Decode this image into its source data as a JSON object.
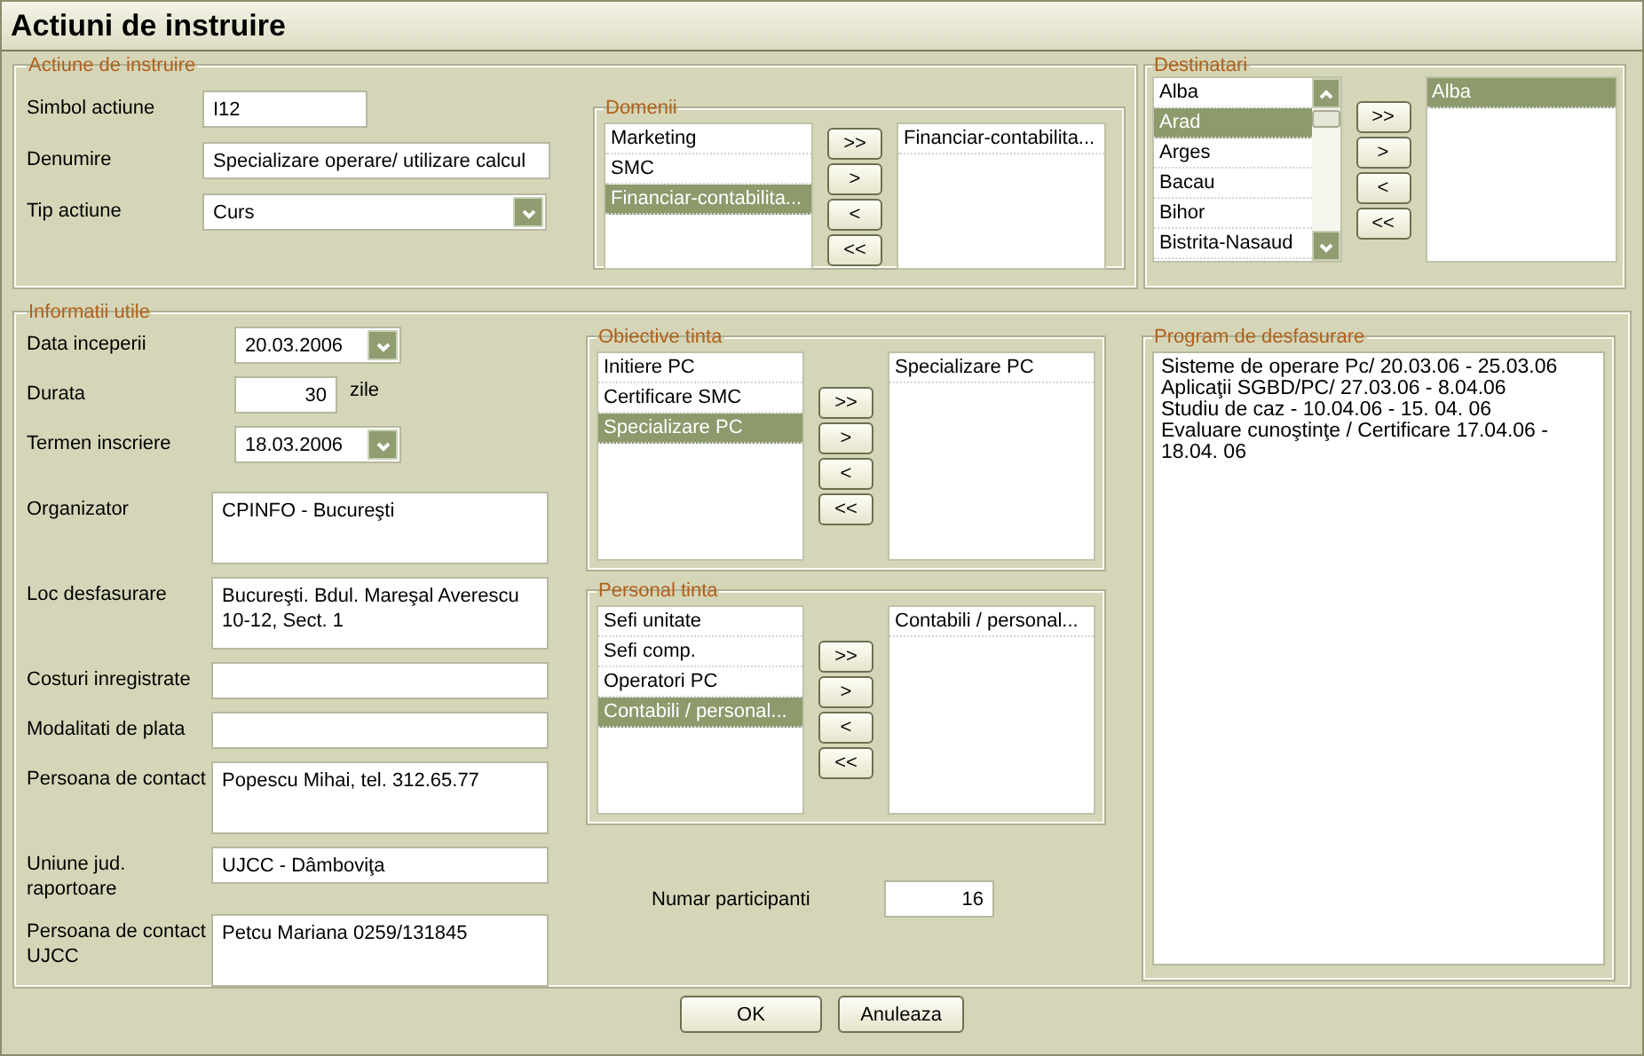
{
  "window": {
    "title": "Actiuni de instruire"
  },
  "actiune": {
    "title": "Actiune de instruire",
    "fields": [
      {
        "label": "Simbol actiune",
        "value": "I12",
        "kind": "short"
      },
      {
        "label": "Denumire",
        "value": "Specializare operare/ utilizare calcul",
        "kind": "text"
      },
      {
        "label": "Tip actiune",
        "value": "Curs",
        "kind": "dropdown"
      }
    ],
    "domenii": {
      "title": "Domenii",
      "available": [
        {
          "label": "Marketing",
          "selected": false
        },
        {
          "label": "SMC",
          "selected": false
        },
        {
          "label": "Financiar-contabilita...",
          "selected": true
        }
      ],
      "chosen": [
        {
          "label": "Financiar-contabilita...",
          "selected": false
        }
      ],
      "buttons": [
        ">>",
        ">",
        "<",
        "<<"
      ]
    }
  },
  "destinatari": {
    "title": "Destinatari",
    "available": [
      {
        "label": "Alba",
        "selected": false
      },
      {
        "label": "Arad",
        "selected": true
      },
      {
        "label": "Arges",
        "selected": false
      },
      {
        "label": "Bacau",
        "selected": false
      },
      {
        "label": "Bihor",
        "selected": false
      },
      {
        "label": "Bistrita-Nasaud",
        "selected": false
      }
    ],
    "chosen": [
      {
        "label": "Alba",
        "selected": true
      }
    ],
    "buttons": [
      ">>",
      ">",
      "<",
      "<<"
    ]
  },
  "informatii": {
    "title": "Informatii utile",
    "fields": [
      {
        "label": "Data inceperii",
        "value": "20.03.2006",
        "kind": "date"
      },
      {
        "label": "Durata",
        "value": "30",
        "unit": "zile",
        "kind": "number"
      },
      {
        "label": "Termen inscriere",
        "value": "18.03.2006",
        "kind": "date"
      },
      {
        "label": "Organizator",
        "value": "CPINFO - Bucureşti",
        "kind": "multiline"
      },
      {
        "label": "Loc desfasurare",
        "value": "Bucureşti. Bdul. Mareşal Averescu 10-12, Sect. 1",
        "kind": "multiline"
      },
      {
        "label": "Costuri inregistrate",
        "kind": "text"
      },
      {
        "label": "Modalitati de plata",
        "kind": "text"
      },
      {
        "label": "Persoana de contact",
        "value": "Popescu Mihai, tel. 312.65.77",
        "kind": "multiline"
      },
      {
        "label": "Uniune jud. raportoare",
        "value": "UJCC - Dâmboviţa",
        "kind": "text"
      },
      {
        "label": "Persoana de contact UJCC",
        "value": "Petcu Mariana 0259/131845",
        "kind": "multiline"
      }
    ],
    "obiective": {
      "title": "Obiective tinta",
      "available": [
        {
          "label": "Initiere PC",
          "selected": false
        },
        {
          "label": "Certificare SMC",
          "selected": false
        },
        {
          "label": "Specializare PC",
          "selected": true
        }
      ],
      "chosen": [
        {
          "label": "Specializare PC",
          "selected": false
        }
      ],
      "buttons": [
        ">>",
        ">",
        "<",
        "<<"
      ]
    },
    "personal": {
      "title": "Personal tinta",
      "available": [
        {
          "label": "Sefi unitate",
          "selected": false
        },
        {
          "label": "Sefi comp.",
          "selected": false
        },
        {
          "label": "Operatori PC",
          "selected": false
        },
        {
          "label": "Contabili / personal...",
          "selected": true
        }
      ],
      "chosen": [
        {
          "label": "Contabili / personal...",
          "selected": false
        }
      ],
      "buttons": [
        ">>",
        ">",
        "<",
        "<<"
      ]
    },
    "numar_participanti": {
      "label": "Numar participanti",
      "value": "16"
    },
    "program": {
      "title": "Program de desfasurare",
      "lines": [
        "Sisteme de operare Pc/ 20.03.06 - 25.03.06",
        "Aplicaţii  SGBD/PC/ 27.03.06 - 8.04.06",
        "Studiu de caz - 10.04.06 - 15. 04. 06",
        "Evaluare cunoştinţe / Certificare 17.04.06 - 18.04. 06"
      ]
    }
  },
  "buttons": [
    "OK",
    "Anuleaza"
  ]
}
